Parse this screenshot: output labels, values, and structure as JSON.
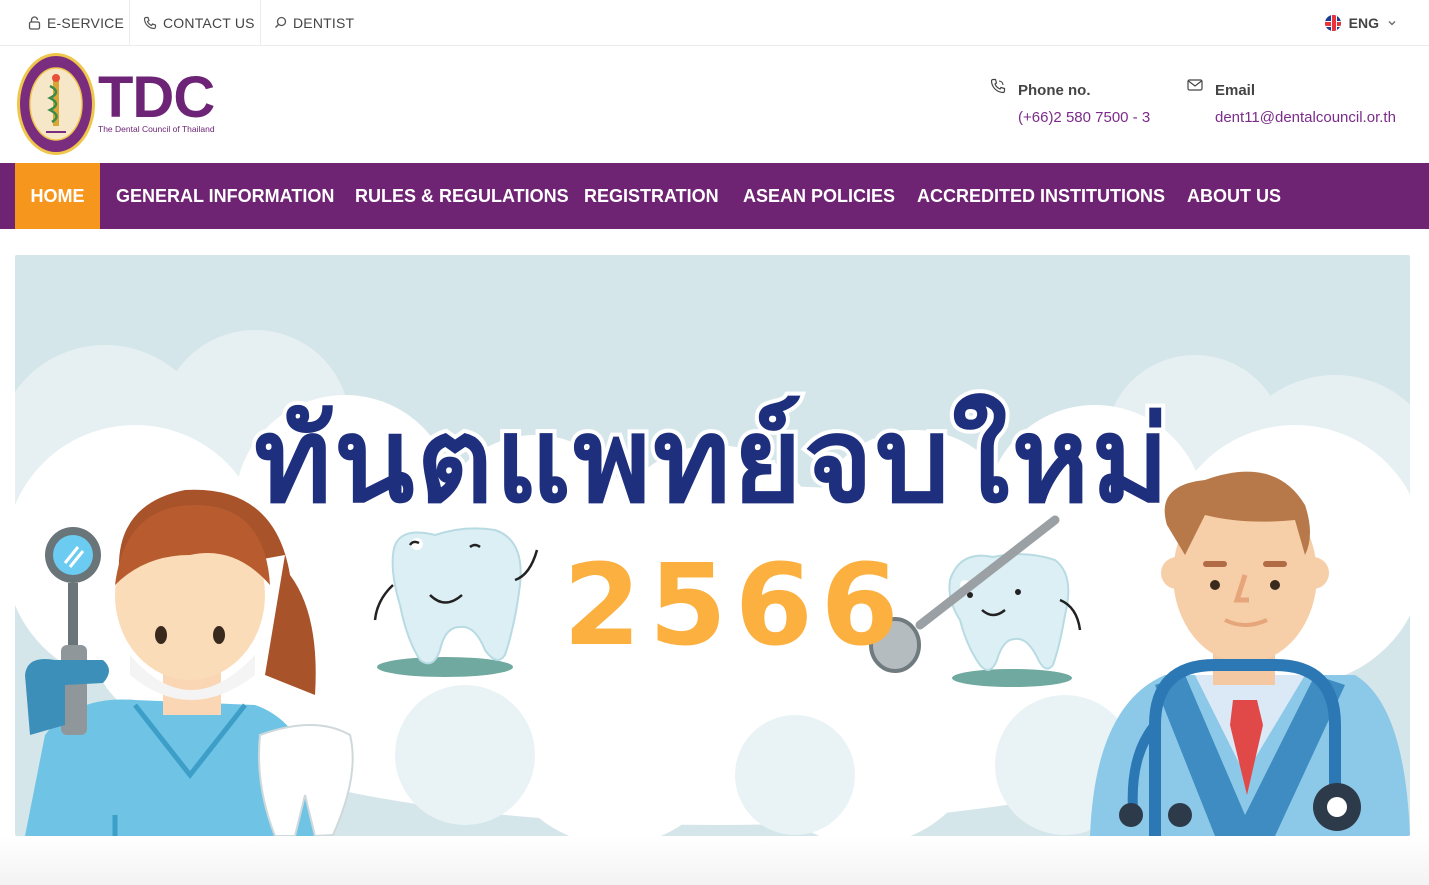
{
  "topbar": {
    "eservice": "E-SERVICE",
    "contact": "CONTACT US",
    "dentist": "DENTIST",
    "language": "ENG"
  },
  "header": {
    "logo_text": "TDC",
    "logo_subtitle": "The Dental Council of Thailand",
    "phone_label": "Phone no.",
    "phone_value": "(+66)2 580 7500 - 3",
    "email_label": "Email",
    "email_value": "dent11@dentalcouncil.or.th"
  },
  "nav": {
    "items": [
      {
        "label": "HOME"
      },
      {
        "label": "GENERAL INFORMATION"
      },
      {
        "label": "RULES & REGULATIONS"
      },
      {
        "label": "REGISTRATION"
      },
      {
        "label": "ASEAN POLICIES"
      },
      {
        "label": "ACCREDITED INSTITUTIONS"
      },
      {
        "label": "ABOUT US"
      }
    ]
  },
  "banner": {
    "title": "ทันตแพทย์จบใหม่",
    "year": "2566"
  },
  "colors": {
    "brand_purple": "#6f2373",
    "nav_active": "#f7961d",
    "link_purple": "#7b2c8a",
    "banner_title": "#1e2f7d",
    "banner_year": "#fbb040"
  },
  "icons": {
    "eservice": "lock-icon",
    "contact": "phone-icon",
    "dentist": "search-icon",
    "language": "uk-flag-icon",
    "dropdown": "chevron-down-icon",
    "phone": "phone-icon",
    "email": "envelope-icon"
  }
}
